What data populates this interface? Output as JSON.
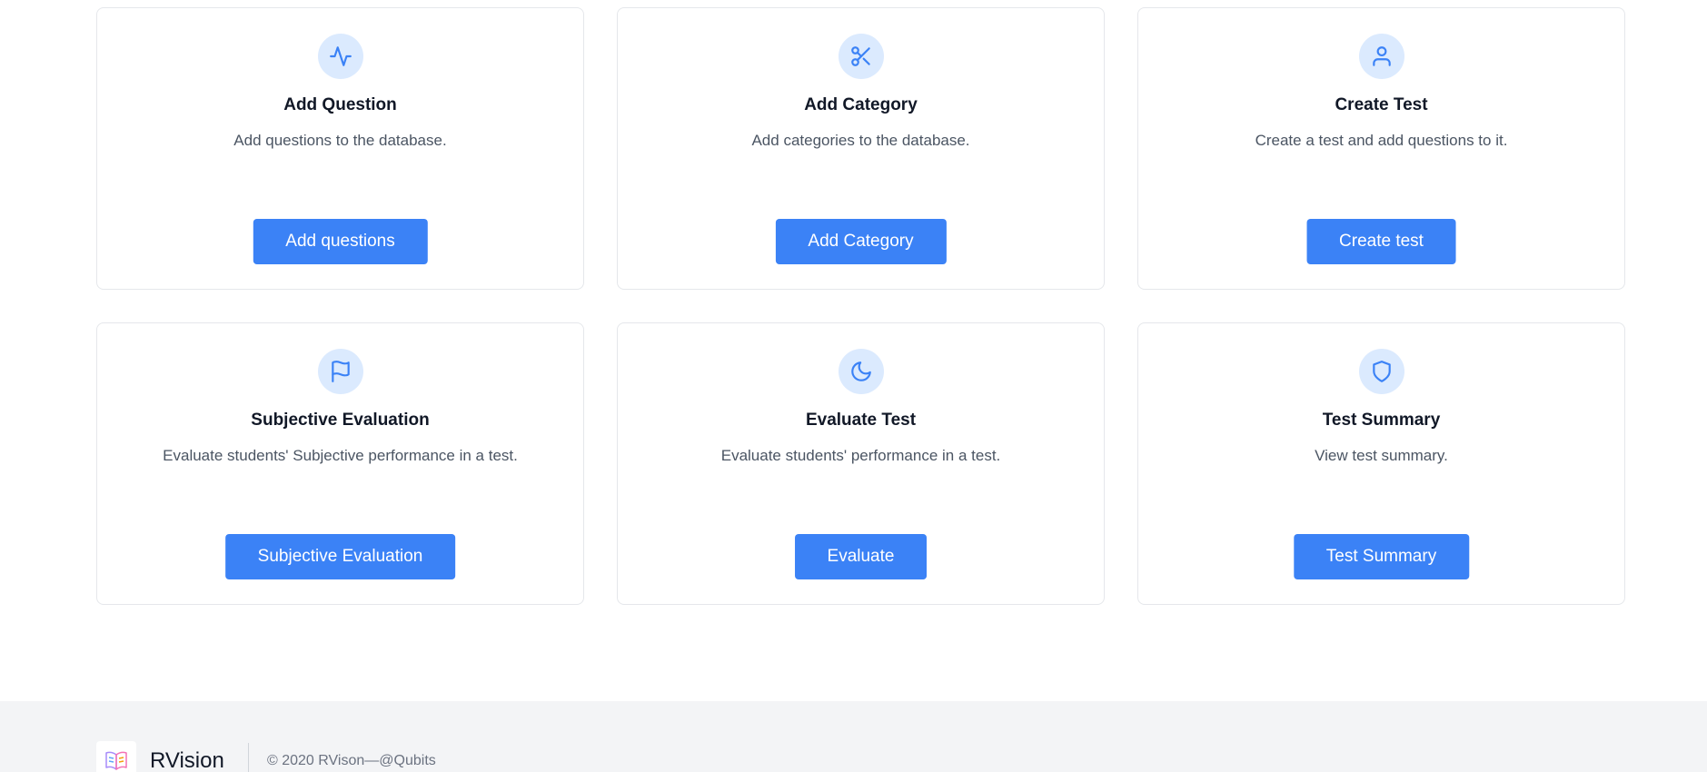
{
  "colors": {
    "accent": "#3b82f6",
    "icon_bg": "#dbeafe",
    "icon_stroke": "#3b82f6",
    "footer_bg": "#f3f4f6"
  },
  "cards": [
    {
      "icon": "activity-icon",
      "title": "Add Question",
      "description": "Add questions to the database.",
      "button": "Add questions"
    },
    {
      "icon": "scissors-icon",
      "title": "Add Category",
      "description": "Add categories to the database.",
      "button": "Add Category"
    },
    {
      "icon": "user-icon",
      "title": "Create Test",
      "description": "Create a test and add questions to it.",
      "button": "Create test"
    },
    {
      "icon": "flag-icon",
      "title": "Subjective Evaluation",
      "description": "Evaluate students' Subjective performance in a test.",
      "button": "Subjective Evaluation"
    },
    {
      "icon": "moon-icon",
      "title": "Evaluate Test",
      "description": "Evaluate students' performance in a test.",
      "button": "Evaluate"
    },
    {
      "icon": "shield-icon",
      "title": "Test Summary",
      "description": "View test summary.",
      "button": "Test Summary"
    }
  ],
  "footer": {
    "logo_icon": "book-icon",
    "brand": "RVision",
    "copyright": "© 2020 RVison—@Qubits"
  }
}
